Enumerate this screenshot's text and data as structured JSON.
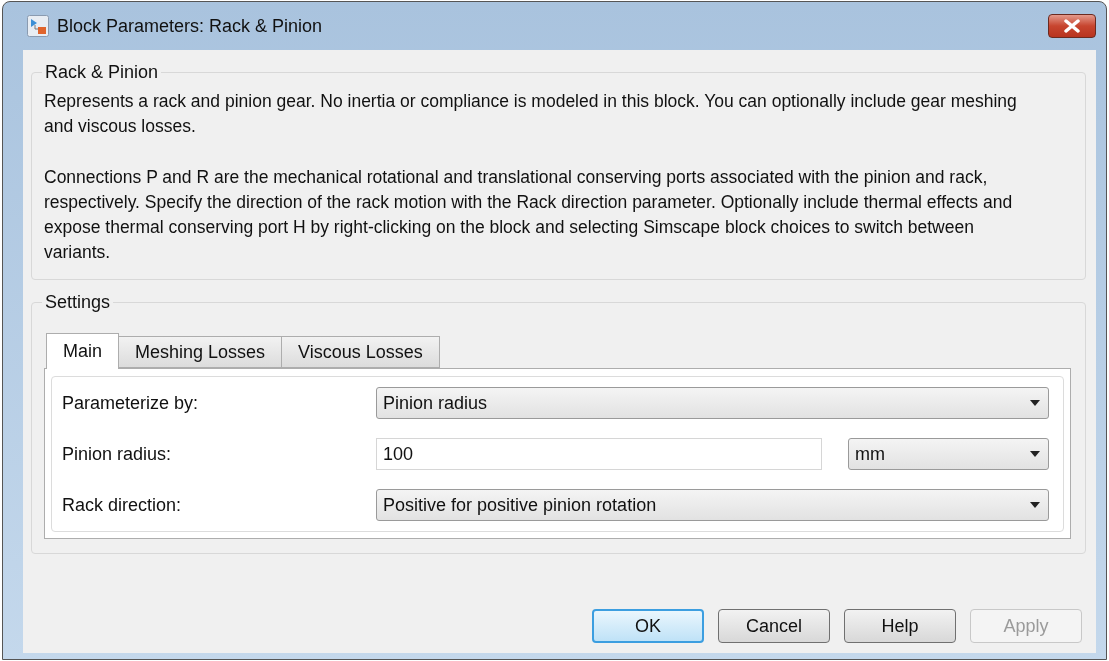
{
  "window": {
    "title": "Block Parameters: Rack & Pinion"
  },
  "description": {
    "title": "Rack & Pinion",
    "paragraphs": [
      "Represents a rack and pinion gear. No inertia or compliance is modeled in this block. You can optionally include gear meshing and viscous losses.",
      "Connections P and R are the mechanical rotational and translational conserving ports associated with the pinion and rack, respectively. Specify the direction of the rack motion with the Rack direction parameter. Optionally include thermal effects and expose thermal conserving port H by right-clicking on the block and selecting Simscape block choices to switch between variants."
    ]
  },
  "settings": {
    "title": "Settings",
    "tabs": [
      {
        "label": "Main",
        "selected": true
      },
      {
        "label": "Meshing Losses",
        "selected": false
      },
      {
        "label": "Viscous Losses",
        "selected": false
      }
    ],
    "parameters": [
      {
        "kind": "dropdown",
        "label": "Parameterize by:",
        "value": "Pinion radius"
      },
      {
        "kind": "value_unit",
        "label": "Pinion radius:",
        "value": "100",
        "unit": "mm"
      },
      {
        "kind": "dropdown",
        "label": "Rack direction:",
        "value": "Positive for positive pinion rotation"
      }
    ]
  },
  "buttons": [
    {
      "label": "OK",
      "focused": true,
      "disabled": false
    },
    {
      "label": "Cancel",
      "focused": false,
      "disabled": false
    },
    {
      "label": "Help",
      "focused": false,
      "disabled": false
    },
    {
      "label": "Apply",
      "focused": false,
      "disabled": true
    }
  ]
}
